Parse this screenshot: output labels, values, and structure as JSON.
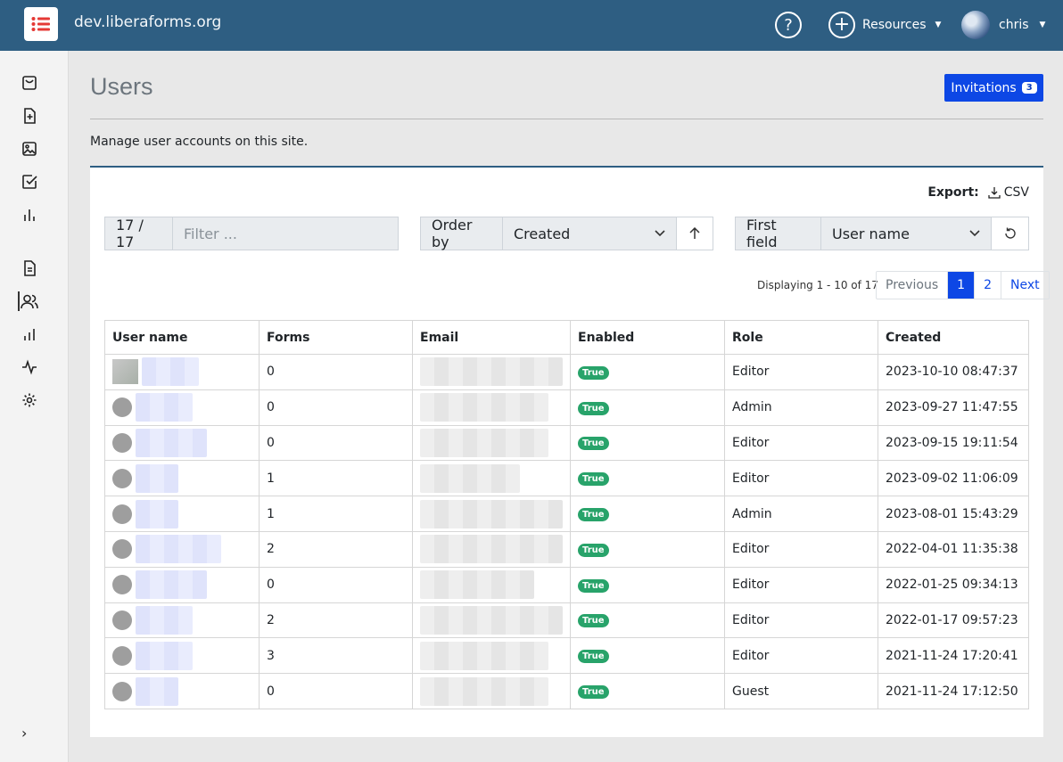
{
  "header": {
    "site_name": "dev.liberaforms.org",
    "help_icon": "question-circle-icon",
    "resources_label": "Resources",
    "username": "chris"
  },
  "sidebar": {
    "items": [
      {
        "name": "forms-bag-icon"
      },
      {
        "name": "new-form-icon"
      },
      {
        "name": "media-icon"
      },
      {
        "name": "consents-icon"
      },
      {
        "name": "stats-icon"
      },
      {
        "name": "site-file-icon"
      },
      {
        "name": "users-icon",
        "active": true
      },
      {
        "name": "site-stats-icon"
      },
      {
        "name": "activity-icon"
      },
      {
        "name": "settings-icon"
      }
    ]
  },
  "page": {
    "title": "Users",
    "description": "Manage user accounts on this site.",
    "invitations_label": "Invitations",
    "invitations_count": "3"
  },
  "toolbar": {
    "export_label": "Export:",
    "csv_label": "CSV",
    "count": "17 / 17",
    "filter_placeholder": "Filter ...",
    "order_by_label": "Order by",
    "order_by_value": "Created",
    "first_field_label": "First field",
    "first_field_value": "User name"
  },
  "pagination": {
    "displaying": "Displaying 1 - 10 of 17",
    "previous": "Previous",
    "pages": [
      "1",
      "2"
    ],
    "next": "Next"
  },
  "table": {
    "headers": [
      "User name",
      "Forms",
      "Email",
      "Enabled",
      "Role",
      "Created"
    ],
    "rows": [
      {
        "forms": "0",
        "enabled": "True",
        "role": "Editor",
        "created": "2023-10-10 08:47:37"
      },
      {
        "forms": "0",
        "enabled": "True",
        "role": "Admin",
        "created": "2023-09-27 11:47:55"
      },
      {
        "forms": "0",
        "enabled": "True",
        "role": "Editor",
        "created": "2023-09-15 19:11:54"
      },
      {
        "forms": "1",
        "enabled": "True",
        "role": "Editor",
        "created": "2023-09-02 11:06:09"
      },
      {
        "forms": "1",
        "enabled": "True",
        "role": "Admin",
        "created": "2023-08-01 15:43:29"
      },
      {
        "forms": "2",
        "enabled": "True",
        "role": "Editor",
        "created": "2022-04-01 11:35:38"
      },
      {
        "forms": "0",
        "enabled": "True",
        "role": "Editor",
        "created": "2022-01-25 09:34:13"
      },
      {
        "forms": "2",
        "enabled": "True",
        "role": "Editor",
        "created": "2022-01-17 09:57:23"
      },
      {
        "forms": "3",
        "enabled": "True",
        "role": "Editor",
        "created": "2021-11-24 17:20:41"
      },
      {
        "forms": "0",
        "enabled": "True",
        "role": "Guest",
        "created": "2021-11-24 17:12:50"
      }
    ]
  },
  "colors": {
    "topbar": "#2e5e82",
    "primary": "#0d47e5",
    "enabled_badge": "#28a36a",
    "logo_accent": "#e53935"
  }
}
